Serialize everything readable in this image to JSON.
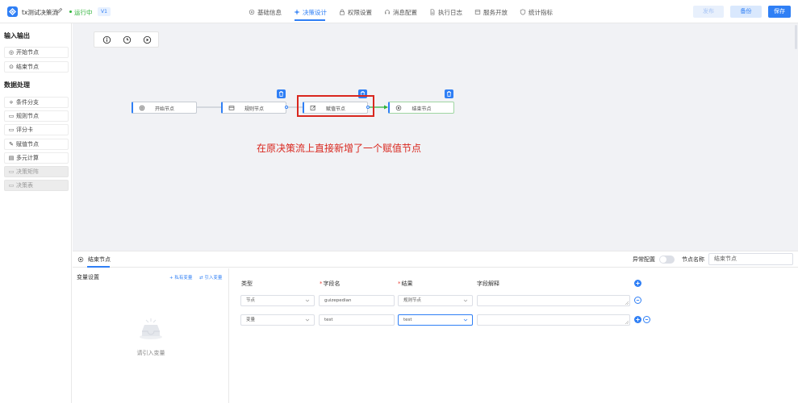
{
  "header": {
    "app_title": "tx测试决策流",
    "status": "运行中",
    "version": "V1",
    "tabs": [
      {
        "label": "基础信息",
        "icon": "settings-icon"
      },
      {
        "label": "决策设计",
        "icon": "flow-icon"
      },
      {
        "label": "权限设置",
        "icon": "lock-icon"
      },
      {
        "label": "消息配置",
        "icon": "headset-icon"
      },
      {
        "label": "执行日志",
        "icon": "document-icon"
      },
      {
        "label": "服务开放",
        "icon": "window-icon"
      },
      {
        "label": "统计指标",
        "icon": "shield-icon"
      }
    ],
    "active_tab": "决策设计",
    "buttons": {
      "publish": "发布",
      "backup": "备份",
      "save": "保存"
    }
  },
  "palette": {
    "io_title": "输入输出",
    "io_items": [
      {
        "icon": "◎",
        "label": "开始节点"
      },
      {
        "icon": "⊙",
        "label": "结束节点"
      }
    ],
    "proc_title": "数据处理",
    "proc_items": [
      {
        "icon": "⟡",
        "label": "条件分支",
        "disabled": false
      },
      {
        "icon": "▭",
        "label": "规则节点",
        "disabled": false
      },
      {
        "icon": "▭",
        "label": "评分卡",
        "disabled": false
      },
      {
        "icon": "✎",
        "label": "赋值节点",
        "disabled": false
      },
      {
        "icon": "▤",
        "label": "多元计算",
        "disabled": false
      },
      {
        "icon": "▭",
        "label": "决策矩阵",
        "disabled": true
      },
      {
        "icon": "▭",
        "label": "决策表",
        "disabled": true
      }
    ]
  },
  "canvas": {
    "tools": [
      "info-icon",
      "clock-icon",
      "play-icon"
    ],
    "nodes": [
      {
        "label": "开始节点",
        "icon": "target-icon"
      },
      {
        "label": "规则节点",
        "icon": "card-icon"
      },
      {
        "label": "赋值节点",
        "icon": "edit-icon"
      },
      {
        "label": "结束节点",
        "icon": "end-icon"
      }
    ],
    "annotation": "在原决策流上直接新增了一个赋值节点"
  },
  "detail": {
    "node_title": "结束节点",
    "anomaly_label": "异常配置",
    "anomaly_enabled": false,
    "node_name_label": "节点名称",
    "node_name_placeholder": "结束节点",
    "var_settings": "变量设置",
    "private_var": "+ 私有变量",
    "import_var": "⇄ 引入变量",
    "empty_text": "请引入变量",
    "columns": {
      "type": "类型",
      "field": "字段名",
      "result": "结果",
      "desc": "字段解释"
    },
    "rows": [
      {
        "type": "节点",
        "field": "guizepedian",
        "result": "规则节点",
        "desc": ""
      },
      {
        "type": "变量",
        "field": "test",
        "result": "test",
        "desc": ""
      }
    ]
  },
  "colors": {
    "accent": "#2f7ff5",
    "success": "#2fb33a",
    "annotation": "#d9271e"
  }
}
